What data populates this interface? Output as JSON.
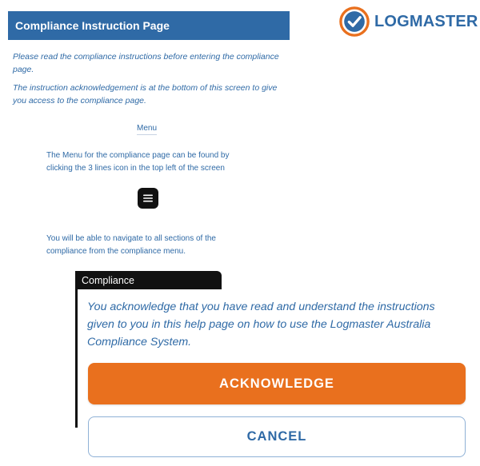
{
  "header": {
    "title": "Compliance Instruction Page"
  },
  "logo": {
    "text": "LOGMASTER",
    "icon": "checkmark-badge-icon"
  },
  "intro": {
    "line1": "Please read the compliance instructions before entering the compliance page.",
    "line2": "The instruction acknowledgement is at the bottom of this screen to give you access to the compliance page."
  },
  "menu": {
    "label": "Menu",
    "description": "The Menu for the compliance page can be found by clicking the 3 lines icon in the top left of the screen",
    "icon": "hamburger-menu-icon",
    "navigation_text": "You will be able to navigate to all sections of the compliance from the compliance menu."
  },
  "compliance": {
    "tab_label": "Compliance",
    "acknowledgement_text": "You acknowledge that you have read and understand the instructions given to you in this help page on how to use the Logmaster Australia Compliance System.",
    "acknowledge_button": "ACKNOWLEDGE",
    "cancel_button": "CANCEL"
  },
  "colors": {
    "brand_blue": "#2f6aa6",
    "accent_orange": "#e9701e",
    "tab_black": "#111111"
  }
}
